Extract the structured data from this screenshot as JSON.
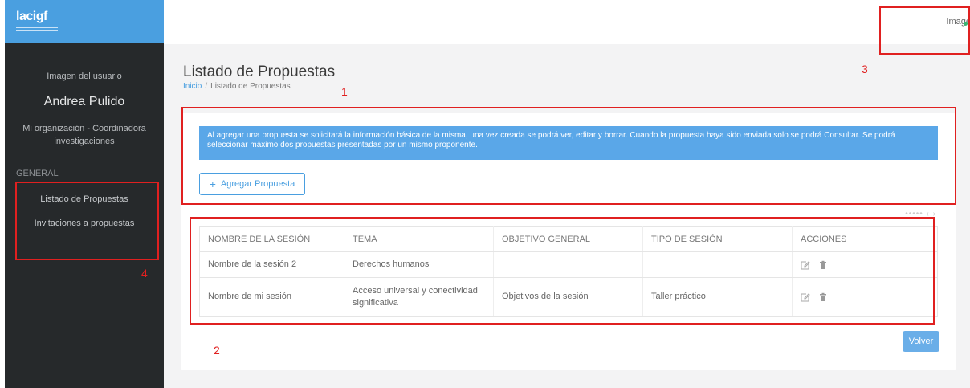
{
  "sidebar": {
    "logo": "lacigf",
    "user_image_label": "Imagen del usuario",
    "user_name": "Andrea Pulido",
    "organization": "Mi organización - Coordinadora investigaciones",
    "section_label": "GENERAL",
    "items": [
      {
        "label": "Listado de Propuestas"
      },
      {
        "label": "Invitaciones a propuestas"
      }
    ]
  },
  "topbar": {
    "user_image_label": "Image"
  },
  "page": {
    "title": "Listado de Propuestas",
    "breadcrumb": {
      "home": "Inicio",
      "separator": "/",
      "current": "Listado de Propuestas"
    }
  },
  "alert": {
    "text": "Al agregar una propuesta se solicitará la información básica de la misma, una vez creada se podrá ver, editar y borrar. Cuando la propuesta haya sido enviada solo se podrá Consultar. Se podrá seleccionar máximo dos propuestas presentadas por un mismo proponente."
  },
  "add_button": {
    "icon": "plus-icon",
    "label": "Agregar Propuesta"
  },
  "table": {
    "headers": [
      "NOMBRE DE LA SESIÓN",
      "TEMA",
      "OBJETIVO GENERAL",
      "TIPO DE SESIÓN",
      "ACCIONES"
    ],
    "rows": [
      {
        "nombre": "Nombre de la sesión 2",
        "tema": "Derechos humanos",
        "objetivo": "",
        "tipo": ""
      },
      {
        "nombre": "Nombre de mi sesión",
        "tema": "Acceso universal y conectividad significativa",
        "objetivo": "Objetivos de la sesión",
        "tipo": "Taller práctico"
      }
    ]
  },
  "back_button": {
    "label": "Volver"
  },
  "annotations": {
    "n1": "1",
    "n2": "2",
    "n3": "3",
    "n4": "4"
  },
  "colors": {
    "accent": "#4a9fe0",
    "sidebar": "#26292b",
    "alert": "#5aa7e8",
    "annotation": "#e02020"
  }
}
